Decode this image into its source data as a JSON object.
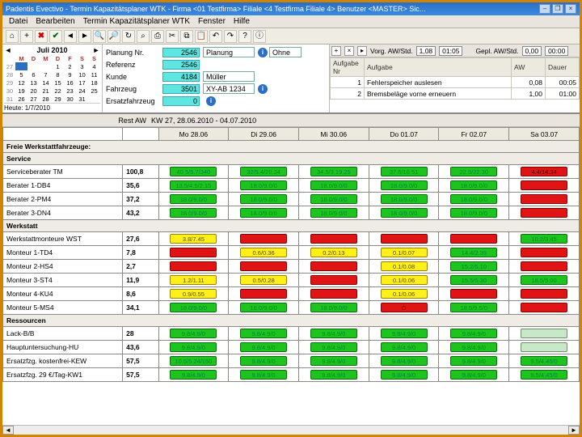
{
  "title_bar": "Padentis Evectivo - Termin Kapazitätsplaner WTK - Firma <01 Testfirma> Filiale <4 Testfirma Filiale 4> Benutzer <MASTER> Sic...",
  "win_btns": {
    "min": "–",
    "max": "❐",
    "close": "×"
  },
  "menu": [
    "Datei",
    "Bearbeiten",
    "Termin Kapazitätsplaner WTK",
    "Fenster",
    "Hilfe"
  ],
  "toolbar_icons": [
    "home",
    "plus",
    "x-red",
    "check-green",
    "nav-prev",
    "nav-next",
    "zoom-out",
    "zoom-in",
    "refresh",
    "find",
    "print",
    "cut",
    "copy",
    "paste",
    "undo",
    "redo",
    "help",
    "info"
  ],
  "calendar": {
    "month_label": "Juli 2010",
    "dow": [
      "M",
      "D",
      "M",
      "D",
      "F",
      "S",
      "S"
    ],
    "weeks": [
      {
        "wk": "27",
        "days": [
          "",
          "",
          "",
          "1",
          "2",
          "3",
          "4"
        ],
        "sel": 0
      },
      {
        "wk": "28",
        "days": [
          "5",
          "6",
          "7",
          "8",
          "9",
          "10",
          "11"
        ]
      },
      {
        "wk": "29",
        "days": [
          "12",
          "13",
          "14",
          "15",
          "16",
          "17",
          "18"
        ]
      },
      {
        "wk": "30",
        "days": [
          "19",
          "20",
          "21",
          "22",
          "23",
          "24",
          "25"
        ]
      },
      {
        "wk": "31",
        "days": [
          "26",
          "27",
          "28",
          "29",
          "30",
          "31",
          ""
        ]
      }
    ],
    "today": "Heute: 1/7/2010"
  },
  "plan": {
    "rows": [
      {
        "label": "Planung Nr.",
        "num": "2546",
        "f1": "Planung",
        "f2": "Ohne"
      },
      {
        "label": "Referenz",
        "num": "2546",
        "f1": "",
        "f2": ""
      },
      {
        "label": "Kunde",
        "num": "4184",
        "f1": "Müller",
        "f2": ""
      },
      {
        "label": "Fahrzeug",
        "num": "3501",
        "f1": "XY-AB 1234",
        "f2": ""
      },
      {
        "label": "Ersatzfahrzeug",
        "num": "0",
        "f1": "",
        "f2": ""
      }
    ]
  },
  "right_bar": {
    "vorg_label": "Vorg. AW/Std.",
    "vorg_val": "1,08",
    "vorg_time": "01:05",
    "gepl_label": "Gepl. AW/Std.",
    "gepl_val": "0,00",
    "gepl_time": "00:00"
  },
  "aufgaben": {
    "cols": [
      "Aufgabe Nr",
      "Aufgabe",
      "AW",
      "Dauer"
    ],
    "rows": [
      {
        "nr": "1",
        "txt": "Fehlerspeicher auslesen",
        "aw": "0,08",
        "dauer": "00:05"
      },
      {
        "nr": "2",
        "txt": "Bremsbeläge vorne erneuern",
        "aw": "1,00",
        "dauer": "01:00"
      }
    ]
  },
  "kw_label": "KW 27, 28.06.2010 - 04.07.2010",
  "day_headers": [
    "Mo 28.06",
    "Di 29.06",
    "Mi 30.06",
    "Do 01.07",
    "Fr 02.07",
    "Sa 03.07"
  ],
  "rest_aw_label": "Rest AW",
  "sections": {
    "freie": "Freie Werkstattfahrzeuge:",
    "service": "Service",
    "werkstatt": "Werkstatt",
    "ressourcen": "Ressourcen"
  },
  "rows": [
    {
      "kind": "section",
      "key": "freie"
    },
    {
      "kind": "section",
      "key": "service"
    },
    {
      "kind": "data",
      "label": "Serviceberater TM",
      "val": "100,8",
      "cells": [
        {
          "c": "g",
          "t": "40.5/5.7/340"
        },
        {
          "c": "g",
          "t": "32/5.4/20.34"
        },
        {
          "c": "g",
          "t": "34.5/3.19.25"
        },
        {
          "c": "g",
          "t": "37.6/16.51"
        },
        {
          "c": "g",
          "t": "22.5/22.30"
        },
        {
          "c": "r",
          "t": "4.4/14.34"
        }
      ]
    },
    {
      "kind": "data",
      "label": "Berater 1-DB4",
      "val": "35,6",
      "cells": [
        {
          "c": "g",
          "t": "13.5/4.5/2.15"
        },
        {
          "c": "g",
          "t": "18.0/9.0/0"
        },
        {
          "c": "g",
          "t": "18.0/9.0/0"
        },
        {
          "c": "g",
          "t": "18.0/9.0/0"
        },
        {
          "c": "g",
          "t": "18.0/9.0/0"
        },
        {
          "c": "r",
          "t": ""
        }
      ]
    },
    {
      "kind": "data",
      "label": "Berater 2-PM4",
      "val": "37,2",
      "cells": [
        {
          "c": "g",
          "t": "18.0/9.0/0"
        },
        {
          "c": "g",
          "t": "18.0/9.0/0"
        },
        {
          "c": "g",
          "t": "18.0/9.0/0"
        },
        {
          "c": "g",
          "t": "18.0/9.0/0"
        },
        {
          "c": "g",
          "t": "18.0/9.0/0"
        },
        {
          "c": "r",
          "t": ""
        }
      ]
    },
    {
      "kind": "data",
      "label": "Berater 3-DN4",
      "val": "43,2",
      "cells": [
        {
          "c": "g",
          "t": "18.0/9.0/0"
        },
        {
          "c": "g",
          "t": "18.0/9.0/0"
        },
        {
          "c": "g",
          "t": "18.0/9.0/0"
        },
        {
          "c": "g",
          "t": "18.0/9.0/0"
        },
        {
          "c": "g",
          "t": "18.0/9.0/0"
        },
        {
          "c": "r",
          "t": ""
        }
      ]
    },
    {
      "kind": "section",
      "key": "werkstatt"
    },
    {
      "kind": "data",
      "label": "Werkstattmonteure WST",
      "val": "27,6",
      "cells": [
        {
          "c": "y",
          "t": "3.8/7.45"
        },
        {
          "c": "r",
          "t": ""
        },
        {
          "c": "r",
          "t": ""
        },
        {
          "c": "r",
          "t": ""
        },
        {
          "c": "r",
          "t": ""
        },
        {
          "c": "g",
          "t": "10.2/3.45"
        }
      ]
    },
    {
      "kind": "data",
      "label": "Monteur 1-TD4",
      "val": "7,8",
      "cells": [
        {
          "c": "r",
          "t": ""
        },
        {
          "c": "y",
          "t": "0.6/0.36"
        },
        {
          "c": "y",
          "t": "0.2/0.13"
        },
        {
          "c": "y",
          "t": "0.1/0.07"
        },
        {
          "c": "g",
          "t": "14.4/2.39"
        },
        {
          "c": "r",
          "t": ""
        }
      ]
    },
    {
      "kind": "data",
      "label": "Monteur 2-HS4",
      "val": "2,7",
      "cells": [
        {
          "c": "r",
          "t": ""
        },
        {
          "c": "r",
          "t": ""
        },
        {
          "c": "r",
          "t": ""
        },
        {
          "c": "y",
          "t": "0.1/0.08"
        },
        {
          "c": "g",
          "t": "15.2/5.10"
        },
        {
          "c": "r",
          "t": ""
        }
      ]
    },
    {
      "kind": "data",
      "label": "Monteur 3-ST4",
      "val": "11,9",
      "cells": [
        {
          "c": "y",
          "t": "1.2/1.11"
        },
        {
          "c": "y",
          "t": "0.5/0.28"
        },
        {
          "c": "r",
          "t": ""
        },
        {
          "c": "y",
          "t": "0.1/0.06"
        },
        {
          "c": "g",
          "t": "15.5/5.30"
        },
        {
          "c": "g",
          "t": "18.5/5.00"
        }
      ]
    },
    {
      "kind": "data",
      "label": "Monteur 4-KU4",
      "val": "8,6",
      "cells": [
        {
          "c": "y",
          "t": "0.9/0.55"
        },
        {
          "c": "r",
          "t": ""
        },
        {
          "c": "r",
          "t": ""
        },
        {
          "c": "y",
          "t": "0.1/0.06"
        },
        {
          "c": "r",
          "t": ""
        },
        {
          "c": "r",
          "t": ""
        }
      ]
    },
    {
      "kind": "data",
      "label": "Monteur 5-MS4",
      "val": "34,1",
      "cells": [
        {
          "c": "g",
          "t": "18.0/9.0/0"
        },
        {
          "c": "g",
          "t": "18.0/9.0/0"
        },
        {
          "c": "g",
          "t": "18.0/9.0/0"
        },
        {
          "c": "r",
          "t": "⏱"
        },
        {
          "c": "g",
          "t": "18.5/9.5/0"
        },
        {
          "c": "r",
          "t": ""
        }
      ]
    },
    {
      "kind": "section",
      "key": "ressourcen"
    },
    {
      "kind": "data",
      "label": "Lack-B/B",
      "val": "28",
      "cells": [
        {
          "c": "g",
          "t": "9.8/4.9/0"
        },
        {
          "c": "g",
          "t": "9.8/4.9/0"
        },
        {
          "c": "g",
          "t": "9.8/4.9/0"
        },
        {
          "c": "g",
          "t": "9.8/4.9/0"
        },
        {
          "c": "g",
          "t": "9.8/4.9/0"
        },
        {
          "c": "sat",
          "t": ""
        }
      ]
    },
    {
      "kind": "data",
      "label": "Hauptuntersuchung-HU",
      "val": "43,6",
      "cells": [
        {
          "c": "g",
          "t": "9.8/4.9/0"
        },
        {
          "c": "g",
          "t": "9.8/4.9/0"
        },
        {
          "c": "g",
          "t": "9.8/4.9/0"
        },
        {
          "c": "g",
          "t": "9.8/4.9/0"
        },
        {
          "c": "g",
          "t": "9.8/4.9/0"
        },
        {
          "c": "sat",
          "t": ""
        }
      ]
    },
    {
      "kind": "data",
      "label": "Ersatzfzg. kostenfrei-KEW",
      "val": "57,5",
      "cells": [
        {
          "c": "g",
          "t": "10.5/5.24/150"
        },
        {
          "c": "g",
          "t": "9.8/4.9/0"
        },
        {
          "c": "g",
          "t": "9.8/4.9/0"
        },
        {
          "c": "g",
          "t": "9.8/4.9/0"
        },
        {
          "c": "g",
          "t": "9.8/4.9/0"
        },
        {
          "c": "g",
          "t": "9.5/4.45/0"
        }
      ]
    },
    {
      "kind": "data",
      "label": "Ersatzfzg. 29 €/Tag-KW1",
      "val": "57,5",
      "cells": [
        {
          "c": "g",
          "t": "9.8/4.9/0"
        },
        {
          "c": "g",
          "t": "9.8/4.9/0"
        },
        {
          "c": "g",
          "t": "9.8/4.9/0"
        },
        {
          "c": "g",
          "t": "9.8/4.9/0"
        },
        {
          "c": "g",
          "t": "9.8/4.9/0"
        },
        {
          "c": "g",
          "t": "9.5/4.45/0"
        }
      ]
    }
  ]
}
